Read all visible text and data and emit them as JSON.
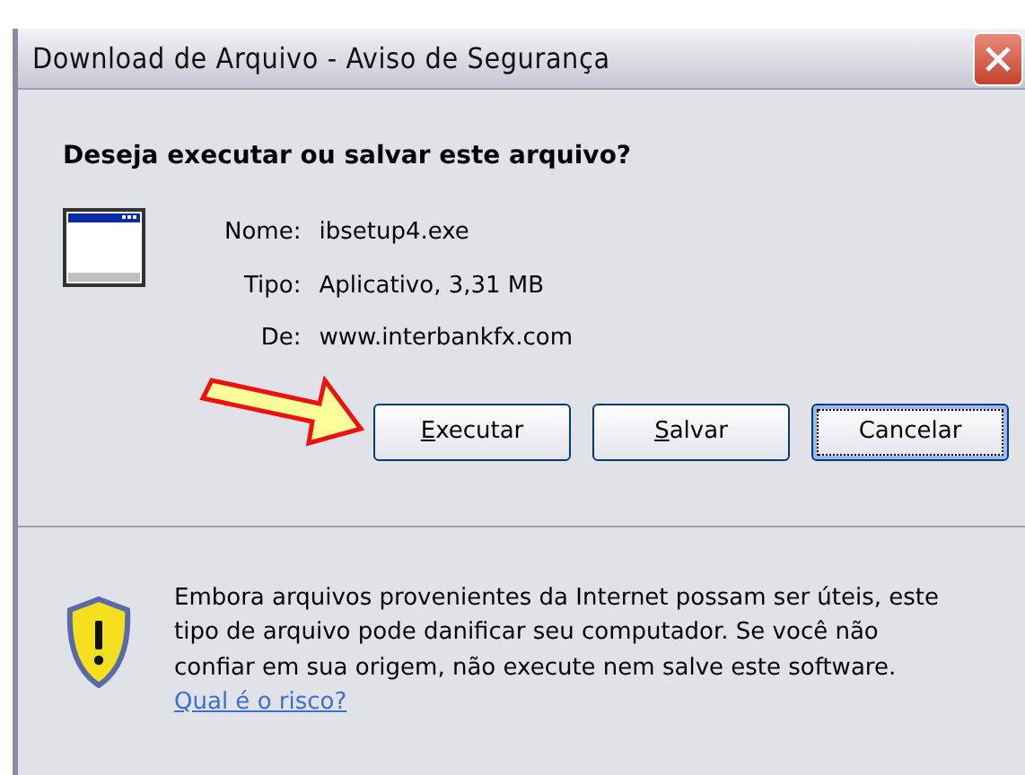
{
  "window": {
    "title": "Download de Arquivo - Aviso de Segurança"
  },
  "question": "Deseja executar ou salvar este arquivo?",
  "details": [
    {
      "label": "Nome:",
      "value": "ibsetup4.exe"
    },
    {
      "label": "Tipo:",
      "value": "Aplicativo, 3,31 MB"
    },
    {
      "label": "De:",
      "value": "www.interbankfx.com"
    }
  ],
  "buttons": [
    {
      "label": "Executar",
      "access_key_underlined": true,
      "focused": false
    },
    {
      "label": "Salvar",
      "access_key_underlined": true,
      "focused": false
    },
    {
      "label": "Cancelar",
      "access_key_underlined": false,
      "focused": true
    }
  ],
  "warning": {
    "text": "Embora arquivos provenientes da Internet possam ser úteis, este tipo de arquivo pode danificar seu computador. Se você não confiar em sua origem, não execute nem salve este software.",
    "link": "Qual é o risco?"
  }
}
